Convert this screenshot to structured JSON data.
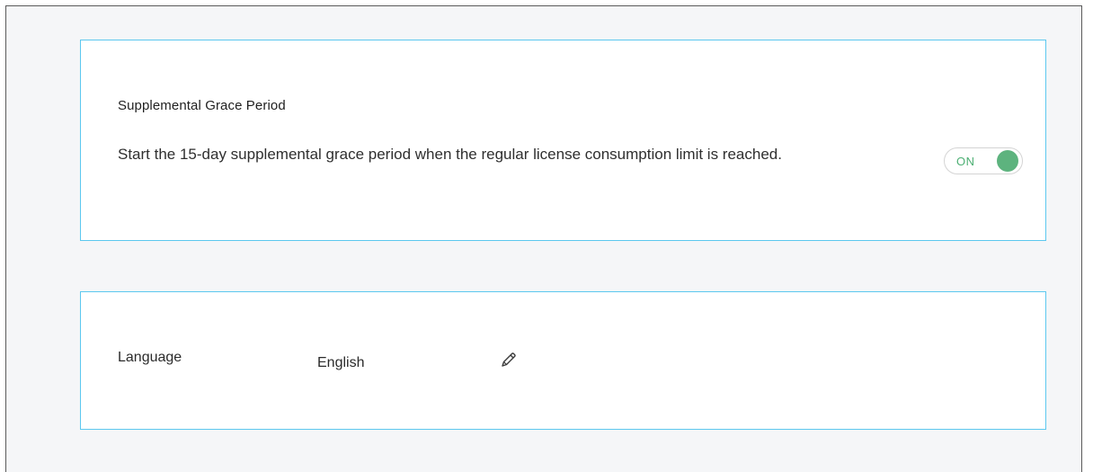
{
  "grace_period": {
    "title": "Supplemental Grace Period",
    "description": "Start the 15-day supplemental grace period when the regular license consumption limit is reached.",
    "toggle": {
      "label": "ON",
      "state": "on",
      "color": "#5db37e"
    }
  },
  "language": {
    "label": "Language",
    "value": "English",
    "edit_icon": "pencil-icon"
  },
  "colors": {
    "card_border": "#5cc8ef",
    "background": "#f5f6f8"
  }
}
